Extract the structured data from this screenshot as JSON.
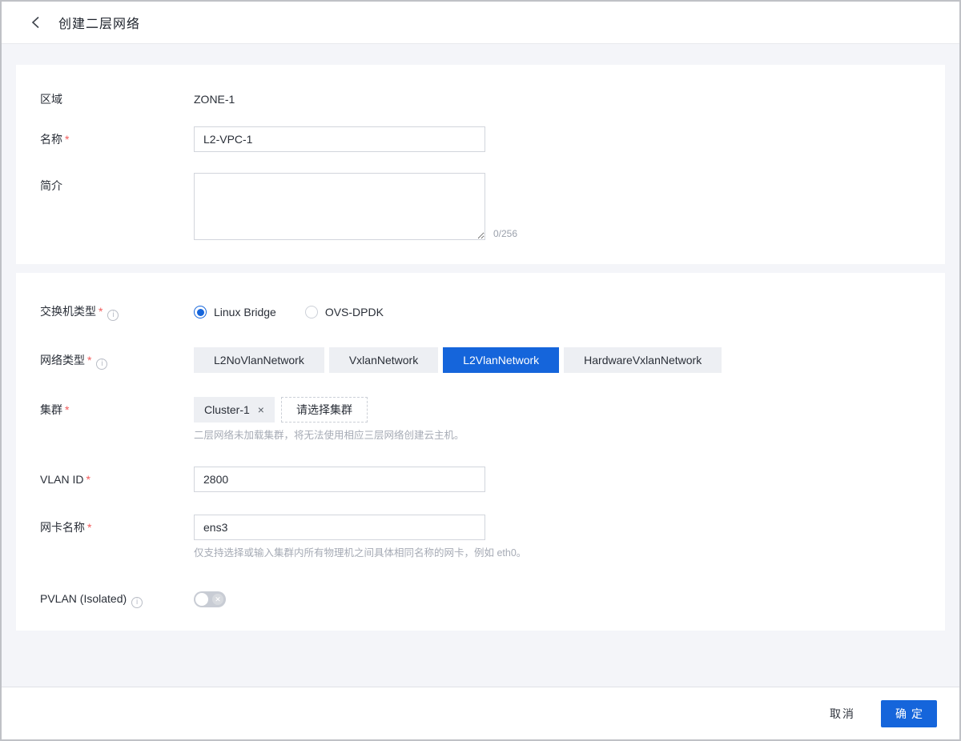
{
  "header": {
    "title": "创建二层网络"
  },
  "icons": {
    "info": "i",
    "tag_close": "×",
    "toggle_off": "✕"
  },
  "form_basic": {
    "zone": {
      "label": "区域",
      "value": "ZONE-1"
    },
    "name": {
      "label": "名称",
      "required_mark": "*",
      "value": "L2-VPC-1"
    },
    "description": {
      "label": "简介",
      "value": "",
      "counter": "0/256"
    }
  },
  "form_network": {
    "switch_type": {
      "label": "交换机类型",
      "required_mark": "*",
      "options": [
        "Linux Bridge",
        "OVS-DPDK"
      ],
      "selected": "Linux Bridge"
    },
    "network_type": {
      "label": "网络类型",
      "required_mark": "*",
      "options": [
        "L2NoVlanNetwork",
        "VxlanNetwork",
        "L2VlanNetwork",
        "HardwareVxlanNetwork"
      ],
      "selected": "L2VlanNetwork"
    },
    "cluster": {
      "label": "集群",
      "required_mark": "*",
      "selected_tag": "Cluster-1",
      "select_placeholder": "请选择集群",
      "helper": "二层网络未加载集群，将无法使用相应三层网络创建云主机。"
    },
    "vlan_id": {
      "label": "VLAN ID",
      "required_mark": "*",
      "value": "2800"
    },
    "nic_name": {
      "label": "网卡名称",
      "required_mark": "*",
      "value": "ens3",
      "helper": "仅支持选择或输入集群内所有物理机之间具体相同名称的网卡，例如 eth0。"
    },
    "pvlan": {
      "label": "PVLAN (Isolated)",
      "state": "off"
    }
  },
  "footer": {
    "cancel_label": "取消",
    "confirm_label": "确定"
  },
  "colors": {
    "primary": "#1565db",
    "page_bg": "#f4f5f9",
    "required": "#f15b5b"
  }
}
